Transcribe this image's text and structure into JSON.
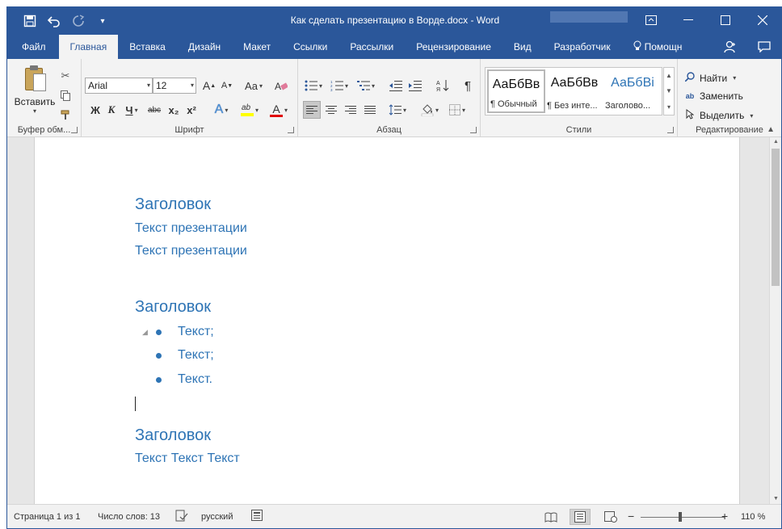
{
  "window": {
    "title": "Как сделать презентацию в Ворде.docx - Word",
    "qat": {
      "save_icon": "save-icon",
      "undo_icon": "undo-icon",
      "redo_icon": "redo-icon",
      "customize_icon": "customize-qat-icon"
    },
    "controls": {
      "ribbon_options": "ribbon-display-options-icon",
      "minimize": "minimize-icon",
      "maximize": "maximize-icon",
      "close": "close-icon"
    }
  },
  "tabs": {
    "file": "Файл",
    "home": "Главная",
    "insert": "Вставка",
    "design": "Дизайн",
    "layout": "Макет",
    "references": "Ссылки",
    "mailings": "Рассылки",
    "review": "Рецензирование",
    "view": "Вид",
    "developer": "Разработчик",
    "help": "Помощн"
  },
  "ribbon": {
    "clipboard": {
      "paste_label": "Вставить",
      "group_label": "Буфер обм..."
    },
    "font": {
      "font_name": "Arial",
      "font_size": "12",
      "group_label": "Шрифт",
      "bold": "Ж",
      "italic": "К",
      "underline": "Ч",
      "strikethrough": "abc",
      "subscript": "x₂",
      "superscript": "x²",
      "grow": "A",
      "shrink": "A",
      "change_case": "Aa",
      "text_color": "A"
    },
    "paragraph": {
      "group_label": "Абзац",
      "show_marks": "¶"
    },
    "styles": {
      "group_label": "Стили",
      "items": [
        {
          "sample": "АаБбВв",
          "name": "¶ Обычный"
        },
        {
          "sample": "АаБбВв",
          "name": "¶ Без инте..."
        },
        {
          "sample": "АаБбВі",
          "name": "Заголово..."
        }
      ]
    },
    "editing": {
      "find": "Найти",
      "replace": "Заменить",
      "select": "Выделить",
      "group_label": "Редактирование"
    }
  },
  "document": {
    "section1": {
      "heading": "Заголовок",
      "lines": [
        "Текст презентации",
        "Текст презентации"
      ]
    },
    "section2": {
      "heading": "Заголовок",
      "bullets": [
        "Текст;",
        "Текст;",
        "Текст."
      ]
    },
    "section3": {
      "heading": "Заголовок",
      "line": "Текст Текст Текст"
    }
  },
  "status": {
    "page": "Страница 1 из 1",
    "words": "Число слов: 13",
    "language": "русский",
    "zoom": "110 %",
    "zoom_minus": "−",
    "zoom_plus": "+"
  },
  "colors": {
    "brand": "#2b579a",
    "heading": "#2e74b5"
  }
}
